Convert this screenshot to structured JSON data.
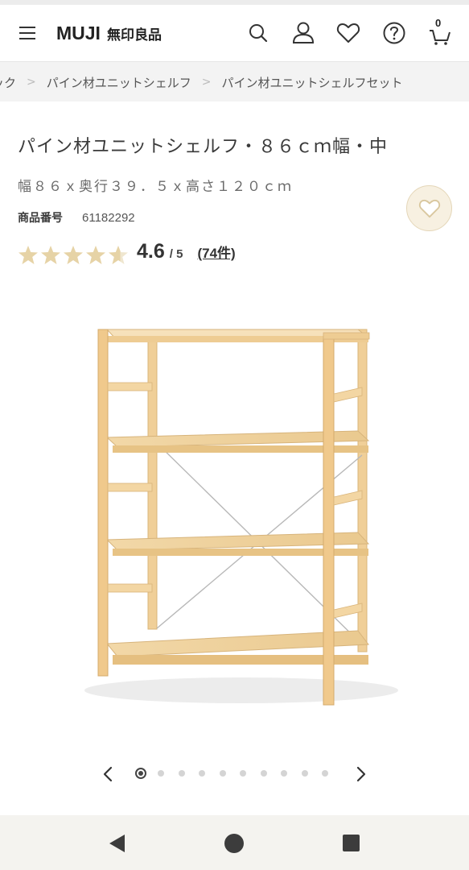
{
  "header": {
    "logo_en": "MUJI",
    "logo_jp": "無印良品",
    "cart_count": "0",
    "icons": [
      "menu-icon",
      "search-icon",
      "account-icon",
      "heart-icon",
      "help-icon",
      "cart-icon"
    ]
  },
  "breadcrumb": {
    "items": [
      "ック",
      "パイン材ユニットシェルフ",
      "パイン材ユニットシェルフセット"
    ],
    "separator": ">"
  },
  "product": {
    "title": "パイン材ユニットシェルフ・８６ｃｍ幅・中",
    "dimensions": "幅８６ｘ奥行３９．５ｘ高さ１２０ｃｍ",
    "sku_label": "商品番号",
    "sku_value": "61182292",
    "rating": 0.92,
    "score": "4.6",
    "score_max": "/ 5",
    "reviews": "(74件)",
    "star_color": "#e6d3a6",
    "star_empty_color": "#efe6cf",
    "favorite_bg": "#f7f0e1"
  },
  "carousel": {
    "total": 10,
    "active_index": 0
  },
  "system_nav": {
    "icons": [
      "back-icon",
      "home-icon",
      "recents-icon"
    ]
  }
}
